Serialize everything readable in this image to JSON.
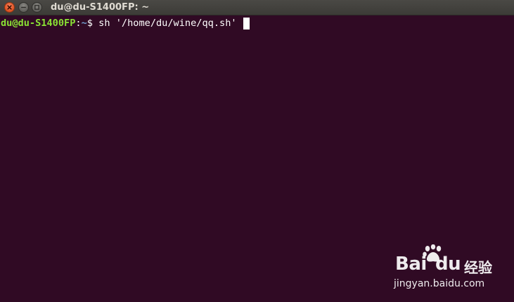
{
  "window": {
    "title": "du@du-S1400FP: ~"
  },
  "terminal": {
    "prompt_user_host": "du@du-S1400FP",
    "prompt_sep": ":",
    "prompt_path": "~",
    "prompt_symbol": "$ ",
    "command": "sh '/home/du/wine/qq.sh' "
  },
  "watermark": {
    "logo_text": "Bai du",
    "logo_left": "Bai",
    "logo_right": "du",
    "suffix": "经验",
    "url": "jingyan.baidu.com"
  },
  "colors": {
    "terminal_bg": "#300a24",
    "prompt_user": "#8ae234",
    "prompt_path": "#729fcf",
    "close_button": "#e05424"
  },
  "icons": [
    "close-icon",
    "minimize-icon",
    "maximize-icon",
    "baidu-paw-icon"
  ]
}
